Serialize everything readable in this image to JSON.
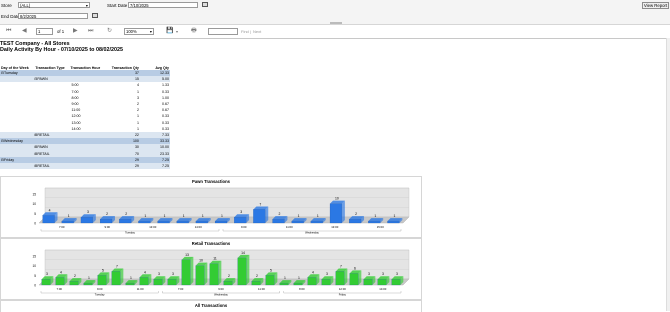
{
  "params": {
    "store_label": "Store",
    "store_value": "(ALL)",
    "end_date_label": "End Date",
    "end_date_value": "8/2/2025",
    "start_date_label": "Start Date",
    "start_date_value": "7/10/2025",
    "view_report_label": "View Report"
  },
  "toolbar": {
    "page_value": "1",
    "page_of": "of 1",
    "zoom_value": "100%",
    "find_label": "Find",
    "next_label": "Next"
  },
  "report": {
    "title_line1": "TEST Company - All Stores",
    "title_line2": "Daily Activity By Hour - 07/10/2025 to  08/02/2025",
    "columns": [
      "Day of the Week",
      "Transaction Type",
      "Transaction Hour",
      "Transaction Qty",
      "Avg Qty"
    ],
    "rows": [
      {
        "band": 1,
        "day": "⊟Tuesday",
        "type": "",
        "hour": "",
        "qty": "37",
        "avg": "12.33"
      },
      {
        "band": 2,
        "day": "",
        "type": "⊟PAWN",
        "hour": "",
        "qty": "15",
        "avg": "5.00"
      },
      {
        "band": 0,
        "day": "",
        "type": "",
        "hour": "5:00",
        "qty": "4",
        "avg": "1.33"
      },
      {
        "band": 0,
        "day": "",
        "type": "",
        "hour": "7:00",
        "qty": "1",
        "avg": "0.33"
      },
      {
        "band": 0,
        "day": "",
        "type": "",
        "hour": "8:00",
        "qty": "3",
        "avg": "1.00"
      },
      {
        "band": 0,
        "day": "",
        "type": "",
        "hour": "9:00",
        "qty": "2",
        "avg": "0.67"
      },
      {
        "band": 0,
        "day": "",
        "type": "",
        "hour": "11:00",
        "qty": "2",
        "avg": "0.67"
      },
      {
        "band": 0,
        "day": "",
        "type": "",
        "hour": "12:00",
        "qty": "1",
        "avg": "0.33"
      },
      {
        "band": 0,
        "day": "",
        "type": "",
        "hour": "13:00",
        "qty": "1",
        "avg": "0.33"
      },
      {
        "band": 0,
        "day": "",
        "type": "",
        "hour": "14:00",
        "qty": "1",
        "avg": "0.33"
      },
      {
        "band": 2,
        "day": "",
        "type": "⊞RETAIL",
        "hour": "",
        "qty": "22",
        "avg": "7.33"
      },
      {
        "band": 1,
        "day": "⊟Wednesday",
        "type": "",
        "hour": "",
        "qty": "100",
        "avg": "33.33"
      },
      {
        "band": 2,
        "day": "",
        "type": "⊞PAWN",
        "hour": "",
        "qty": "30",
        "avg": "10.00"
      },
      {
        "band": 2,
        "day": "",
        "type": "⊞RETAIL",
        "hour": "",
        "qty": "70",
        "avg": "23.33"
      },
      {
        "band": 1,
        "day": "⊟Friday",
        "type": "",
        "hour": "",
        "qty": "29",
        "avg": "7.25"
      },
      {
        "band": 2,
        "day": "",
        "type": "⊞RETAIL",
        "hour": "",
        "qty": "29",
        "avg": "7.25"
      }
    ]
  },
  "chart_data": [
    {
      "type": "bar",
      "title": "Pawn Transactions",
      "color": "#2b78e4",
      "ylim": [
        0,
        15
      ],
      "yticks": [
        "0",
        "5",
        "10",
        "15"
      ],
      "values": [
        4,
        1,
        3,
        2,
        2,
        1,
        1,
        1,
        1,
        1,
        3,
        7,
        2,
        1,
        1,
        10,
        2,
        1,
        1
      ],
      "xticks": [
        "7:00",
        "9:00",
        "13:00",
        "14:00",
        "9:00",
        "11:00",
        "13:00",
        "15:00"
      ],
      "groups": [
        "Tuesday",
        "Wednesday"
      ]
    },
    {
      "type": "bar",
      "title": "Retail Transactions",
      "color": "#33cc33",
      "ylim": [
        0,
        15
      ],
      "yticks": [
        "0",
        "5",
        "10",
        "15"
      ],
      "values": [
        3,
        4,
        2,
        1,
        5,
        7,
        1,
        4,
        3,
        3,
        13,
        10,
        11,
        2,
        14,
        2,
        5,
        1,
        1,
        4,
        3,
        7,
        6,
        3,
        3,
        3
      ],
      "xticks": [
        "7:00",
        "9:00",
        "11:00",
        "7:00",
        "9:00",
        "11:00",
        "8:00",
        "12:00",
        "14:00"
      ],
      "groups": [
        "Tuesday",
        "Wednesday",
        "Friday"
      ]
    },
    {
      "type": "bar",
      "title": "All Transactions"
    }
  ],
  "colors": {
    "band1": "#b8cce4",
    "band2": "#dce6f1",
    "pawn": "#2b78e4",
    "retail": "#33cc33"
  }
}
